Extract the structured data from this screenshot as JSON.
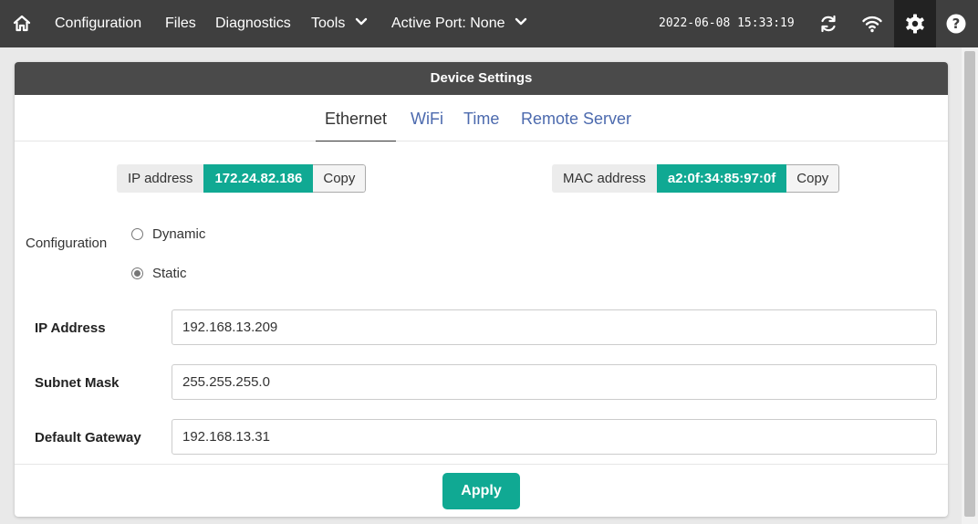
{
  "nav": {
    "home_icon": "home-icon",
    "items": [
      {
        "label": "Configuration"
      },
      {
        "label": "Files"
      },
      {
        "label": "Diagnostics"
      },
      {
        "label": "Tools"
      },
      {
        "label": "Active Port: None"
      }
    ],
    "datetime": "2022-06-08 15:33:19",
    "icons": [
      "sync-icon",
      "wifi-icon",
      "gear-icon",
      "help-icon"
    ]
  },
  "card": {
    "title": "Device Settings",
    "tabs": [
      {
        "label": "Ethernet",
        "active": true
      },
      {
        "label": "WiFi"
      },
      {
        "label": "Time"
      },
      {
        "label": "Remote Server"
      }
    ],
    "ip_info": {
      "label": "IP address",
      "value": "172.24.82.186",
      "copy": "Copy"
    },
    "mac_info": {
      "label": "MAC address",
      "value": "a2:0f:34:85:97:0f",
      "copy": "Copy"
    },
    "configuration": {
      "label": "Configuration",
      "options": [
        {
          "label": "Dynamic",
          "checked": false
        },
        {
          "label": "Static",
          "checked": true
        }
      ]
    },
    "fields": {
      "ip_address": {
        "label": "IP Address",
        "value": "192.168.13.209"
      },
      "subnet_mask": {
        "label": "Subnet Mask",
        "value": "255.255.255.0"
      },
      "default_gateway": {
        "label": "Default Gateway",
        "value": "192.168.13.31"
      }
    },
    "apply_label": "Apply"
  },
  "colors": {
    "topbar": "#3f3f3f",
    "accent": "#10a993",
    "tab_link": "#4c6aae"
  }
}
